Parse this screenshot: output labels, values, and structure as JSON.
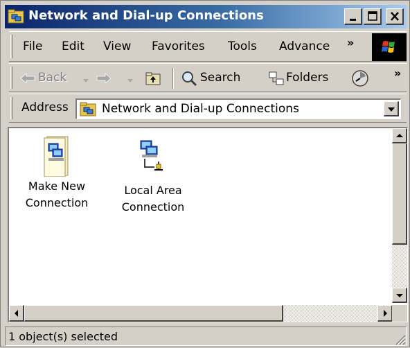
{
  "window": {
    "title": "Network and Dial-up Connections",
    "icon": "network-connections-folder-icon",
    "controls": [
      "minimize",
      "maximize",
      "close"
    ]
  },
  "menubar": {
    "items": [
      "File",
      "Edit",
      "View",
      "Favorites",
      "Tools",
      "Advance"
    ],
    "overflow": "»"
  },
  "toolbar": {
    "back_label": "Back",
    "search_label": "Search",
    "folders_label": "Folders",
    "overflow": "»"
  },
  "address": {
    "label": "Address",
    "value": "Network and Dial-up Connections"
  },
  "items": [
    {
      "label": "Make New\nConnection",
      "icon": "make-new-connection-icon"
    },
    {
      "label": "Local Area\nConnection",
      "icon": "local-area-connection-icon"
    }
  ],
  "status": {
    "text": "1 object(s) selected"
  },
  "colors": {
    "titlebar_start": "#0a246a",
    "titlebar_end": "#a6caf0",
    "face": "#d4d0c8"
  }
}
